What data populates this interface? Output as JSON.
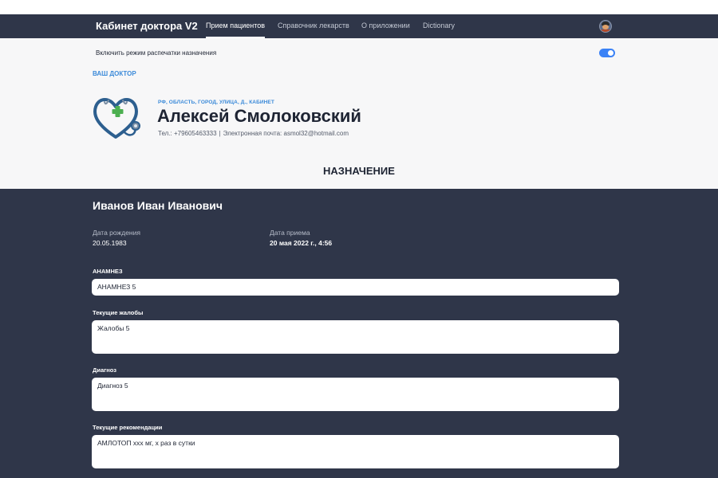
{
  "navbar": {
    "brand": "Кабинет доктора V2",
    "links": [
      {
        "label": "Прием пациентов",
        "active": true
      },
      {
        "label": "Справочник лекарств",
        "active": false
      },
      {
        "label": "О приложении",
        "active": false
      },
      {
        "label": "Dictionary",
        "active": false
      }
    ]
  },
  "print_mode": {
    "label": "Включить режим распечатки назначения",
    "enabled": true
  },
  "doctor": {
    "section_link": "ВАШ ДОКТОР",
    "address": "РФ, ОБЛАСТЬ, ГОРОД, УЛИЦА, Д., КАБИНЕТ",
    "name": "Алексей Смолоковский",
    "phone": "Тел.: +79605463333",
    "email": "Электронная почта: asmol32@hotmail.com"
  },
  "prescription_title": "НАЗНАЧЕНИЕ",
  "patient": {
    "name": "Иванов Иван Иванович",
    "birth_label": "Дата рождения",
    "birth_value": "20.05.1983",
    "visit_label": "Дата приема",
    "visit_value": "20 мая 2022 г., 4:56"
  },
  "fields": {
    "anamnesis": {
      "label": "АНАМНЕЗ",
      "value": "АНАМНЕЗ 5"
    },
    "complaints": {
      "label": "Текущие жалобы",
      "value": "Жалобы 5"
    },
    "diagnosis": {
      "label": "Диагноз",
      "value": "Диагноз 5"
    },
    "recommendations": {
      "label": "Текущие рекомендации",
      "value": "АМЛОТОП ххх мг, х раз в сутки"
    }
  },
  "colors": {
    "navbar_bg": "#2f3649",
    "accent": "#3b8ad9",
    "toggle_on": "#3b82f6"
  }
}
